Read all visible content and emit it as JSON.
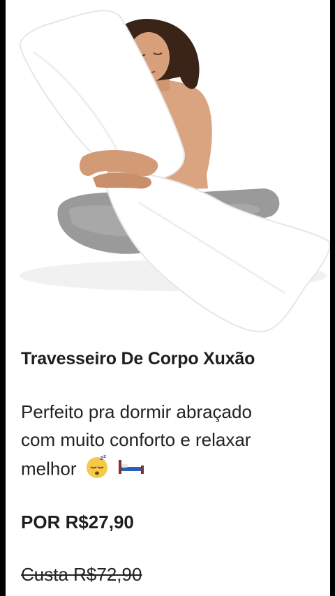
{
  "product": {
    "image_alt": "woman-hugging-body-pillow",
    "title": "Travesseiro De Corpo Xuxão",
    "description_line1": "Perfeito pra dormir abraçado",
    "description_line2": "com muito conforto e relaxar",
    "description_line3": "melhor",
    "description_emojis": [
      "sleeping-face-icon",
      "bed-icon"
    ],
    "price": "POR R$27,90",
    "old_price": "Custa R$72,90"
  },
  "colors": {
    "background": "#ffffff",
    "text": "#222222",
    "frame": "#000000"
  }
}
